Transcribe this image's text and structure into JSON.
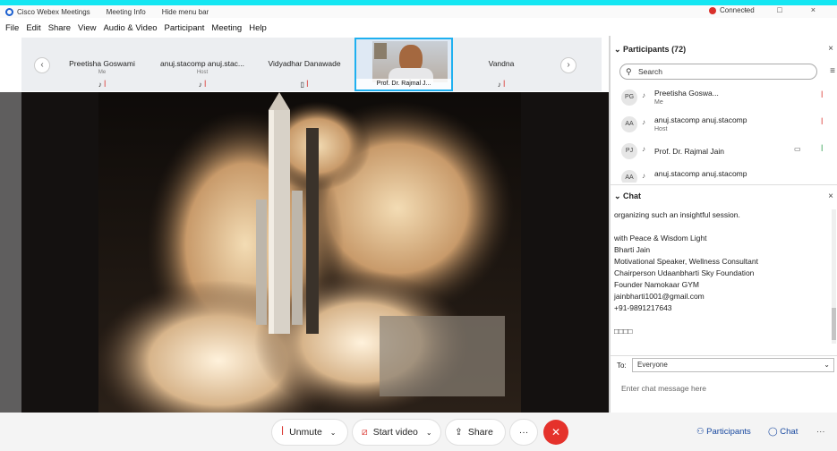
{
  "window": {
    "app_title": "Cisco Webex Meetings",
    "meeting_info": "Meeting Info",
    "hide_menu": "Hide menu bar",
    "status": "Connected",
    "min": "–",
    "max": "□",
    "close": "×"
  },
  "menu": [
    "File",
    "Edit",
    "Share",
    "View",
    "Audio & Video",
    "Participant",
    "Meeting",
    "Help"
  ],
  "thumbnails": [
    {
      "name": "Preetisha Goswami",
      "sub": "Me"
    },
    {
      "name": "anuj.stacomp anuj.stac...",
      "sub": "Host"
    },
    {
      "name": "Vidyadhar Danawade",
      "sub": ""
    },
    {
      "name": "Prof. Dr. Rajmal J...",
      "sub": ""
    },
    {
      "name": "Vandna",
      "sub": ""
    }
  ],
  "participants_panel": {
    "title": "Participants (72)",
    "search_placeholder": "Search",
    "list": [
      {
        "initials": "PG",
        "name": "Preetisha Goswa...",
        "role": "Me"
      },
      {
        "initials": "AA",
        "name": "anuj.stacomp anuj.stacomp",
        "role": "Host"
      },
      {
        "initials": "PJ",
        "name": "Prof. Dr. Rajmal Jain",
        "role": ""
      },
      {
        "initials": "AA",
        "name": "anuj.stacomp anuj.stacomp",
        "role": ""
      }
    ]
  },
  "chat_panel": {
    "title": "Chat",
    "messages": [
      "organizing such an insightful session.",
      "",
      "with Peace & Wisdom Light",
      "Bharti Jain",
      "Motivational Speaker, Wellness Consultant",
      "Chairperson Udaanbharti Sky Foundation",
      "Founder Namokaar GYM",
      "jainbharti1001@gmail.com",
      "+91-9891217643",
      "",
      "□□□□"
    ],
    "to_label": "To:",
    "to_value": "Everyone",
    "input_placeholder": "Enter chat message here"
  },
  "controls": {
    "unmute": "Unmute",
    "start_video": "Start video",
    "share": "Share",
    "more": "···",
    "end": "✕",
    "participants": "Participants",
    "chat": "Chat",
    "overflow": "···"
  },
  "colors": {
    "accent_cyan": "#14e6f2",
    "end_red": "#e5322b",
    "mute_red": "#d9312b",
    "active_border": "#1fb0f0"
  }
}
